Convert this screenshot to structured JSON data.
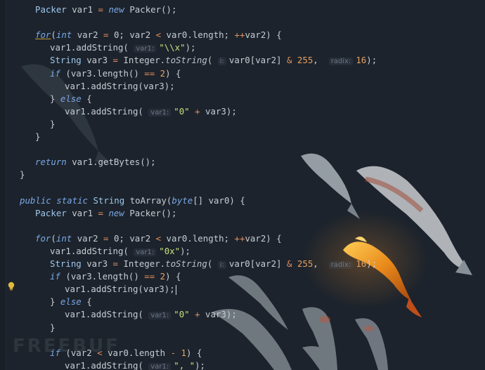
{
  "colors": {
    "background": "#1c232c",
    "keyword": "#7aa8e6",
    "string": "#c4e17e",
    "number": "#e7a25f",
    "text": "#c6cdd4"
  },
  "lines": [
    {
      "indent": 2,
      "tokens": [
        [
          "type",
          "Packer"
        ],
        [
          "txt",
          " var1 "
        ],
        [
          "op",
          "="
        ],
        [
          "txt",
          " "
        ],
        [
          "kw",
          "new"
        ],
        [
          "txt",
          " Packer();"
        ]
      ]
    },
    {
      "indent": 0,
      "tokens": []
    },
    {
      "indent": 2,
      "tokens": [
        [
          "kw",
          "for"
        ],
        [
          "txt",
          "("
        ],
        [
          "kw",
          "int"
        ],
        [
          "txt",
          " var2 "
        ],
        [
          "op",
          "="
        ],
        [
          "txt",
          " 0; var2 "
        ],
        [
          "op",
          "<"
        ],
        [
          "txt",
          " var0.length; "
        ],
        [
          "op",
          "++"
        ],
        [
          "txt",
          "var2) {"
        ]
      ]
    },
    {
      "indent": 3,
      "tokens": [
        [
          "txt",
          "var1.addString( "
        ],
        [
          "hint",
          "var1:"
        ],
        [
          "str",
          "\"\\\\x\""
        ],
        [
          "txt",
          ");"
        ]
      ]
    },
    {
      "indent": 3,
      "tokens": [
        [
          "type",
          "String"
        ],
        [
          "txt",
          " var3 "
        ],
        [
          "op",
          "="
        ],
        [
          "txt",
          " Integer."
        ],
        [
          "meth",
          "toString"
        ],
        [
          "txt",
          "( "
        ],
        [
          "hint",
          "i:"
        ],
        [
          "txt",
          "var0[var2] "
        ],
        [
          "op",
          "&"
        ],
        [
          "txt",
          " "
        ],
        [
          "num",
          "255"
        ],
        [
          "txt",
          ",  "
        ],
        [
          "hint",
          "radix:"
        ],
        [
          "num",
          "16"
        ],
        [
          "txt",
          ");"
        ]
      ]
    },
    {
      "indent": 3,
      "tokens": [
        [
          "kw",
          "if"
        ],
        [
          "txt",
          " (var3.length() "
        ],
        [
          "op",
          "=="
        ],
        [
          "txt",
          " "
        ],
        [
          "num",
          "2"
        ],
        [
          "txt",
          ") {"
        ]
      ]
    },
    {
      "indent": 4,
      "tokens": [
        [
          "txt",
          "var1.addString(var3);"
        ]
      ]
    },
    {
      "indent": 3,
      "tokens": [
        [
          "txt",
          "} "
        ],
        [
          "kw",
          "else"
        ],
        [
          "txt",
          " {"
        ]
      ]
    },
    {
      "indent": 4,
      "tokens": [
        [
          "txt",
          "var1.addString( "
        ],
        [
          "hint",
          "var1:"
        ],
        [
          "str",
          "\"0\""
        ],
        [
          "txt",
          " "
        ],
        [
          "op",
          "+"
        ],
        [
          "txt",
          " var3);"
        ]
      ]
    },
    {
      "indent": 3,
      "tokens": [
        [
          "txt",
          "}"
        ]
      ]
    },
    {
      "indent": 2,
      "tokens": [
        [
          "txt",
          "}"
        ]
      ]
    },
    {
      "indent": 0,
      "tokens": []
    },
    {
      "indent": 2,
      "tokens": [
        [
          "kw",
          "return"
        ],
        [
          "txt",
          " var1.getBytes();"
        ]
      ]
    },
    {
      "indent": 1,
      "tokens": [
        [
          "txt",
          "}"
        ]
      ]
    },
    {
      "indent": 0,
      "tokens": []
    },
    {
      "indent": 1,
      "tokens": [
        [
          "kw",
          "public"
        ],
        [
          "txt",
          " "
        ],
        [
          "kw",
          "static"
        ],
        [
          "txt",
          " "
        ],
        [
          "type",
          "String"
        ],
        [
          "txt",
          " toArray("
        ],
        [
          "kw",
          "byte"
        ],
        [
          "txt",
          "[] var0) {"
        ]
      ]
    },
    {
      "indent": 2,
      "tokens": [
        [
          "type",
          "Packer"
        ],
        [
          "txt",
          " var1 "
        ],
        [
          "op",
          "="
        ],
        [
          "txt",
          " "
        ],
        [
          "kw",
          "new"
        ],
        [
          "txt",
          " Packer();"
        ]
      ]
    },
    {
      "indent": 0,
      "tokens": []
    },
    {
      "indent": 2,
      "tokens": [
        [
          "kw",
          "for"
        ],
        [
          "txt",
          "("
        ],
        [
          "kw",
          "int"
        ],
        [
          "txt",
          " var2 "
        ],
        [
          "op",
          "="
        ],
        [
          "txt",
          " 0; var2 "
        ],
        [
          "op",
          "<"
        ],
        [
          "txt",
          " var0.length; "
        ],
        [
          "op",
          "++"
        ],
        [
          "txt",
          "var2) {"
        ]
      ]
    },
    {
      "indent": 3,
      "tokens": [
        [
          "txt",
          "var1.addString( "
        ],
        [
          "hint",
          "var1:"
        ],
        [
          "str",
          "\"0x\""
        ],
        [
          "txt",
          ");"
        ]
      ]
    },
    {
      "indent": 3,
      "tokens": [
        [
          "type",
          "String"
        ],
        [
          "txt",
          " var3 "
        ],
        [
          "op",
          "="
        ],
        [
          "txt",
          " Integer."
        ],
        [
          "meth",
          "toString"
        ],
        [
          "txt",
          "( "
        ],
        [
          "hint",
          "i:"
        ],
        [
          "txt",
          "var0[var2] "
        ],
        [
          "op",
          "&"
        ],
        [
          "txt",
          " "
        ],
        [
          "num",
          "255"
        ],
        [
          "txt",
          ",  "
        ],
        [
          "hint",
          "radix:"
        ],
        [
          "num",
          "16"
        ],
        [
          "txt",
          ");"
        ]
      ]
    },
    {
      "indent": 3,
      "tokens": [
        [
          "kw",
          "if"
        ],
        [
          "txt",
          " (var3.length() "
        ],
        [
          "op",
          "=="
        ],
        [
          "txt",
          " "
        ],
        [
          "num",
          "2"
        ],
        [
          "txt",
          ") {"
        ]
      ]
    },
    {
      "indent": 4,
      "tokens": [
        [
          "txt",
          "var1.addString(var3);"
        ]
      ],
      "caret": true
    },
    {
      "indent": 3,
      "tokens": [
        [
          "txt",
          "} "
        ],
        [
          "kw",
          "else"
        ],
        [
          "txt",
          " {"
        ]
      ]
    },
    {
      "indent": 4,
      "tokens": [
        [
          "txt",
          "var1.addString( "
        ],
        [
          "hint",
          "var1:"
        ],
        [
          "str",
          "\"0\""
        ],
        [
          "txt",
          " "
        ],
        [
          "op",
          "+"
        ],
        [
          "txt",
          " var3);"
        ]
      ]
    },
    {
      "indent": 3,
      "tokens": [
        [
          "txt",
          "}"
        ]
      ]
    },
    {
      "indent": 0,
      "tokens": []
    },
    {
      "indent": 3,
      "tokens": [
        [
          "kw",
          "if"
        ],
        [
          "txt",
          " (var2 "
        ],
        [
          "op",
          "<"
        ],
        [
          "txt",
          " var0.length "
        ],
        [
          "op",
          "-"
        ],
        [
          "txt",
          " "
        ],
        [
          "num",
          "1"
        ],
        [
          "txt",
          ") {"
        ]
      ]
    },
    {
      "indent": 4,
      "tokens": [
        [
          "txt",
          "var1.addString( "
        ],
        [
          "hint",
          "var1:"
        ],
        [
          "str",
          "\", \""
        ],
        [
          "txt",
          ");"
        ]
      ]
    }
  ],
  "gutter": {
    "bulb_icon": "lightbulb-icon"
  },
  "watermark": "FREEBUF"
}
